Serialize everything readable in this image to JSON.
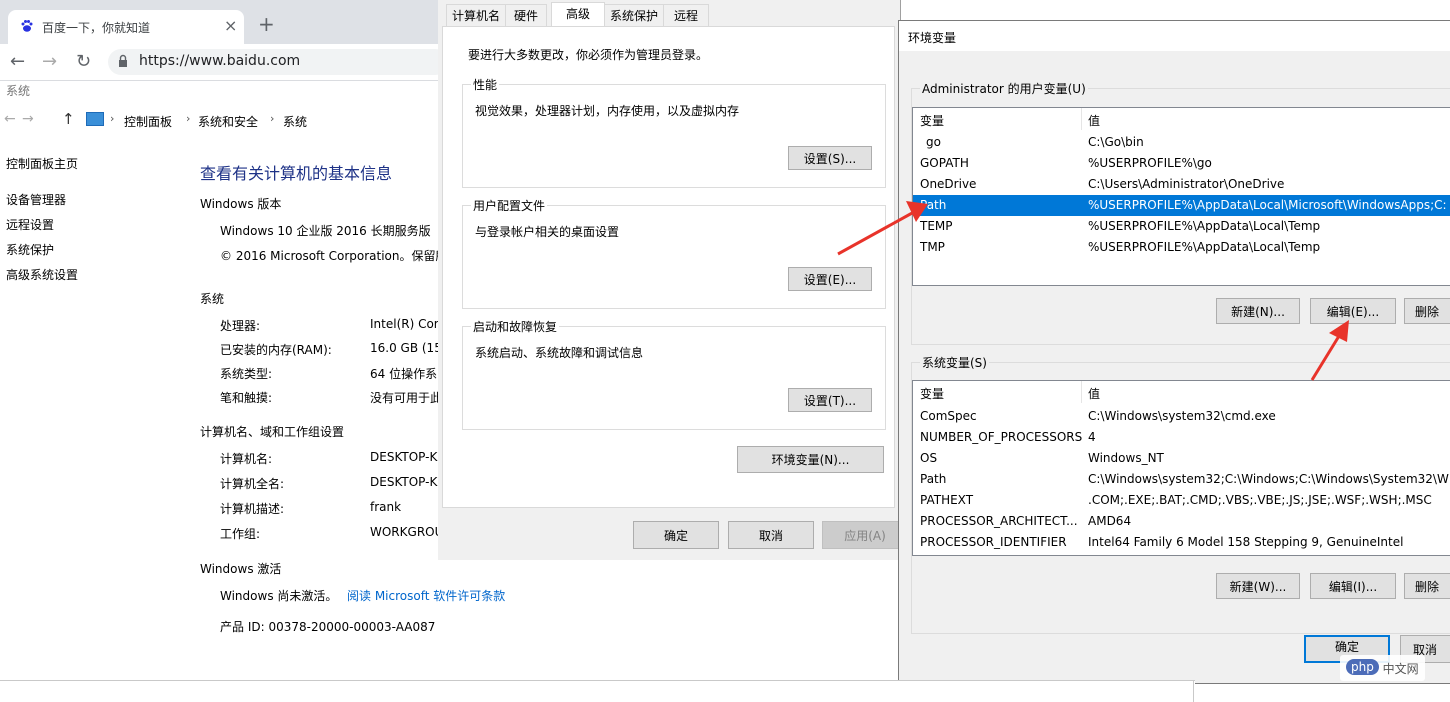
{
  "browser": {
    "tab_title": "百度一下，你就知道",
    "close_glyph": "×",
    "new_tab_glyph": "+",
    "url": "https://www.baidu.com",
    "back_glyph": "←",
    "forward_glyph": "→",
    "reload_glyph": "↻"
  },
  "system_window": {
    "title": "系统",
    "nav": {
      "back": "←",
      "forward": "→",
      "up": "↑",
      "sep": "›"
    },
    "breadcrumb": [
      "控制面板",
      "系统和安全",
      "系统"
    ],
    "sidebar": {
      "home": "控制面板主页",
      "links": [
        "设备管理器",
        "远程设置",
        "系统保护",
        "高级系统设置"
      ]
    },
    "heading": "查看有关计算机的基本信息",
    "edition": {
      "label": "Windows 版本",
      "name": "Windows 10 企业版 2016 长期服务版",
      "copyright": "© 2016 Microsoft Corporation。保留所"
    },
    "system": {
      "label": "系统",
      "rows": [
        {
          "k": "处理器:",
          "v": "Intel(R) Cor"
        },
        {
          "k": "已安装的内存(RAM):",
          "v": "16.0 GB (15"
        },
        {
          "k": "系统类型:",
          "v": "64 位操作系"
        },
        {
          "k": "笔和触摸:",
          "v": "没有可用于此"
        }
      ]
    },
    "computer": {
      "label": "计算机名、域和工作组设置",
      "rows": [
        {
          "k": "计算机名:",
          "v": "DESKTOP-K"
        },
        {
          "k": "计算机全名:",
          "v": "DESKTOP-K"
        },
        {
          "k": "计算机描述:",
          "v": "frank"
        },
        {
          "k": "工作组:",
          "v": "WORKGROU"
        }
      ]
    },
    "activation": {
      "label": "Windows 激活",
      "status": "Windows 尚未激活。",
      "link": "阅读 Microsoft 软件许可条款",
      "product_id": "产品 ID: 00378-20000-00003-AA087"
    }
  },
  "system_properties": {
    "tabs": [
      "计算机名",
      "硬件",
      "高级",
      "系统保护",
      "远程"
    ],
    "active_tab": "高级",
    "admin_note": "要进行大多数更改，你必须作为管理员登录。",
    "groups": [
      {
        "title": "性能",
        "desc": "视觉效果，处理器计划，内存使用，以及虚拟内存",
        "button": "设置(S)..."
      },
      {
        "title": "用户配置文件",
        "desc": "与登录帐户相关的桌面设置",
        "button": "设置(E)..."
      },
      {
        "title": "启动和故障恢复",
        "desc": "系统启动、系统故障和调试信息",
        "button": "设置(T)..."
      }
    ],
    "env_button": "环境变量(N)...",
    "ok": "确定",
    "cancel": "取消",
    "apply": "应用(A)"
  },
  "env_dialog": {
    "title": "环境变量",
    "user_group": "Administrator 的用户变量(U)",
    "col_var": "变量",
    "col_val": "值",
    "user_vars": [
      {
        "name": "go",
        "value": "C:\\Go\\bin"
      },
      {
        "name": "GOPATH",
        "value": "%USERPROFILE%\\go"
      },
      {
        "name": "OneDrive",
        "value": "C:\\Users\\Administrator\\OneDrive"
      },
      {
        "name": "Path",
        "value": "%USERPROFILE%\\AppData\\Local\\Microsoft\\WindowsApps;C:"
      },
      {
        "name": "TEMP",
        "value": "%USERPROFILE%\\AppData\\Local\\Temp"
      },
      {
        "name": "TMP",
        "value": "%USERPROFILE%\\AppData\\Local\\Temp"
      }
    ],
    "selected_user_var": "Path",
    "user_buttons": {
      "new": "新建(N)...",
      "edit": "编辑(E)...",
      "delete": "删除"
    },
    "sys_group": "系统变量(S)",
    "sys_vars": [
      {
        "name": "ComSpec",
        "value": "C:\\Windows\\system32\\cmd.exe"
      },
      {
        "name": "NUMBER_OF_PROCESSORS",
        "value": "4"
      },
      {
        "name": "OS",
        "value": "Windows_NT"
      },
      {
        "name": "Path",
        "value": "C:\\Windows\\system32;C:\\Windows;C:\\Windows\\System32\\W"
      },
      {
        "name": "PATHEXT",
        "value": ".COM;.EXE;.BAT;.CMD;.VBS;.VBE;.JS;.JSE;.WSF;.WSH;.MSC"
      },
      {
        "name": "PROCESSOR_ARCHITECT...",
        "value": "AMD64"
      },
      {
        "name": "PROCESSOR_IDENTIFIER",
        "value": "Intel64 Family 6 Model 158 Stepping 9, GenuineIntel"
      }
    ],
    "sys_buttons": {
      "new": "新建(W)...",
      "edit": "编辑(I)...",
      "delete": "删除"
    },
    "ok": "确定",
    "cancel": "取消"
  },
  "annotations": {
    "arrow_color": "#e8332a"
  },
  "watermark": {
    "logo": "php",
    "text": "中文网"
  },
  "colors": {
    "selection": "#0078d7",
    "link": "#0066cc",
    "heading": "#1e3287"
  }
}
